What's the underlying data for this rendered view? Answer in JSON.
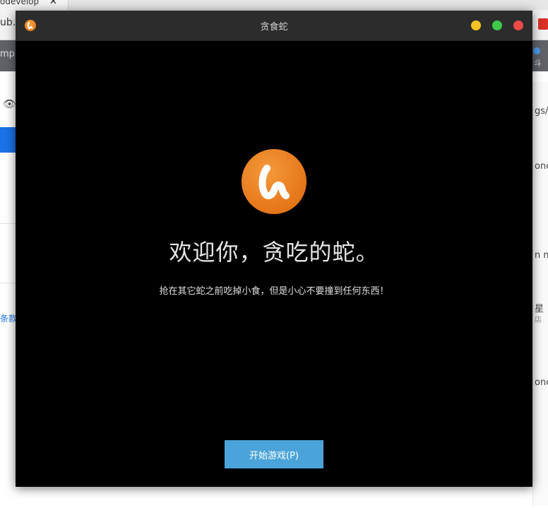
{
  "background": {
    "tab_title": "odevelop",
    "tab_close": "✕",
    "url_fragment": "ub.c",
    "toolbar_fragment": "mp",
    "toolbar_right_fragment": "斗",
    "left_link": "条款",
    "right_texts": [
      "gs/t",
      "onc",
      "n m",
      "星",
      "店",
      "onc"
    ]
  },
  "window": {
    "title": "贪食蛇",
    "heading": "欢迎你，贪吃的蛇。",
    "subtitle": "抢在其它蛇之前吃掉小食，但是小心不要撞到任何东西！",
    "start_button": "开始游戏(P)",
    "colors": {
      "accent": "#4aa3d9",
      "logo": "#e57619",
      "titlebar": "#2c2c2c",
      "background": "#000000",
      "minimize": "#f5c124",
      "maximize": "#3ec94a",
      "close": "#ec4b4a"
    },
    "icons": {
      "app": "snake-app-icon",
      "logo": "snake-logo-icon"
    }
  }
}
